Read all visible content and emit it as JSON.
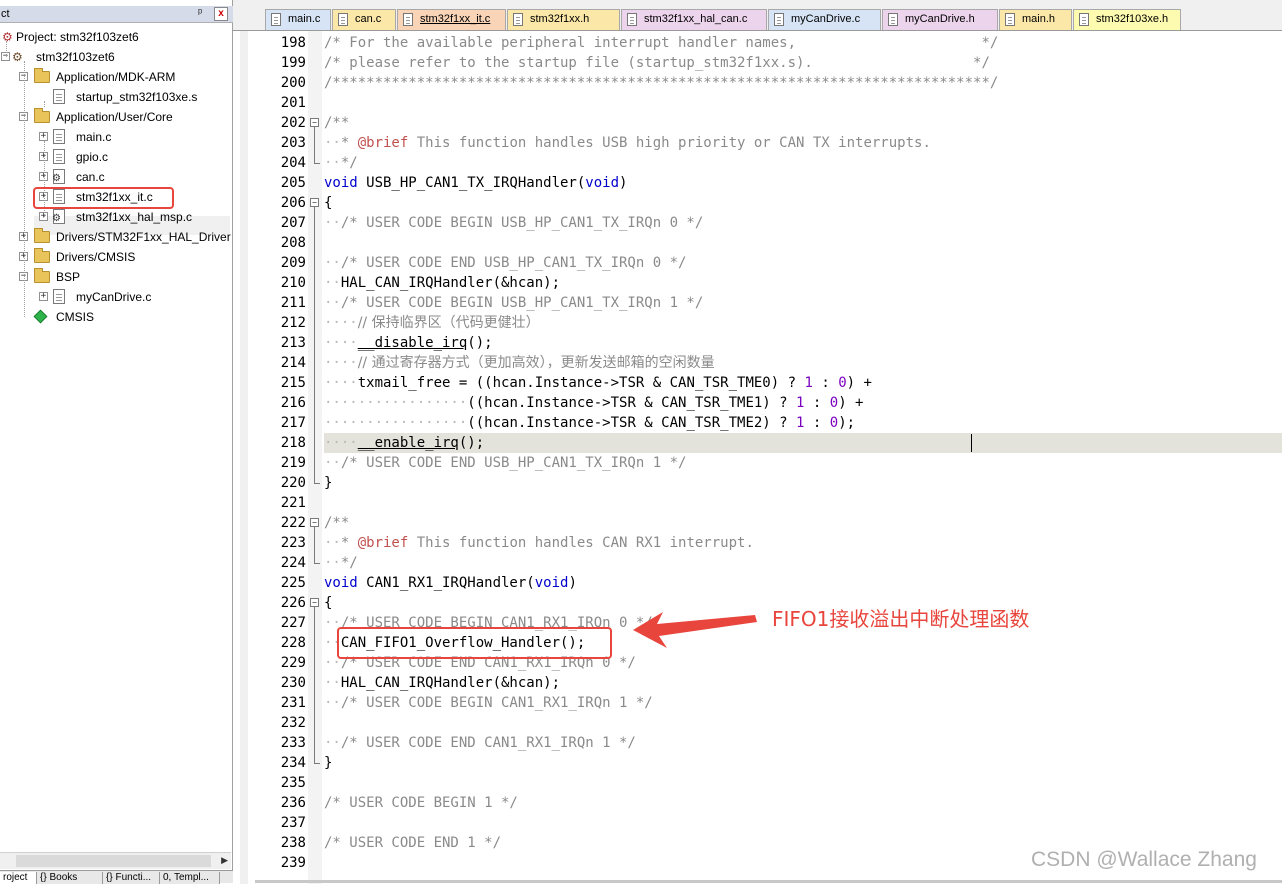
{
  "panel": {
    "title": "ct",
    "pin": "ᵖ",
    "close": "x"
  },
  "tree": [
    {
      "label": "Project: stm32f103zet6",
      "indent": 0,
      "expander": "",
      "icon": "project"
    },
    {
      "label": "stm32f103zet6",
      "indent": 1,
      "expander": "−",
      "icon": "target"
    },
    {
      "label": "Application/MDK-ARM",
      "indent": 2,
      "expander": "−",
      "icon": "folder"
    },
    {
      "label": "startup_stm32f103xe.s",
      "indent": 3,
      "expander": "",
      "icon": "file"
    },
    {
      "label": "Application/User/Core",
      "indent": 2,
      "expander": "−",
      "icon": "folder"
    },
    {
      "label": "main.c",
      "indent": 3,
      "expander": "+",
      "icon": "file"
    },
    {
      "label": "gpio.c",
      "indent": 3,
      "expander": "+",
      "icon": "file"
    },
    {
      "label": "can.c",
      "indent": 3,
      "expander": "+",
      "icon": "gear-file"
    },
    {
      "label": "stm32f1xx_it.c",
      "indent": 3,
      "expander": "+",
      "icon": "file"
    },
    {
      "label": "stm32f1xx_hal_msp.c",
      "indent": 3,
      "expander": "+",
      "icon": "gear-file"
    },
    {
      "label": "Drivers/STM32F1xx_HAL_Driver",
      "indent": 2,
      "expander": "+",
      "icon": "folder"
    },
    {
      "label": "Drivers/CMSIS",
      "indent": 2,
      "expander": "+",
      "icon": "folder"
    },
    {
      "label": "BSP",
      "indent": 2,
      "expander": "−",
      "icon": "folder"
    },
    {
      "label": "myCanDrive.c",
      "indent": 3,
      "expander": "+",
      "icon": "file"
    },
    {
      "label": "CMSIS",
      "indent": 2,
      "expander": "",
      "icon": "cmsis"
    }
  ],
  "bottom_tabs": [
    "roject",
    "{} Books",
    "{} Functi...",
    "0, Templ..."
  ],
  "tabs": [
    {
      "label": "main.c",
      "color": "#d6e4f5",
      "active": false
    },
    {
      "label": "can.c",
      "color": "#fbe8a8",
      "active": false
    },
    {
      "label": "stm32f1xx_it.c",
      "color": "#f9d4b7",
      "active": true
    },
    {
      "label": "stm32f1xx.h",
      "color": "#fbe8a8",
      "active": false
    },
    {
      "label": "stm32f1xx_hal_can.c",
      "color": "#ecd5ec",
      "active": false
    },
    {
      "label": "myCanDrive.c",
      "color": "#d6e4f5",
      "active": false
    },
    {
      "label": "myCanDrive.h",
      "color": "#ecd5ec",
      "active": false
    },
    {
      "label": "main.h",
      "color": "#fbe8a8",
      "active": false
    },
    {
      "label": "stm32f103xe.h",
      "color": "#fdfbb0",
      "active": false
    }
  ],
  "code_lines": [
    {
      "n": "198",
      "fold": "",
      "parts": [
        [
          "c-cm",
          "/* For the available peripheral interrupt handler names,                      */"
        ]
      ]
    },
    {
      "n": "199",
      "fold": "",
      "parts": [
        [
          "c-cm",
          "/* please refer to the startup file (startup_stm32f1xx.s).                   */"
        ]
      ]
    },
    {
      "n": "200",
      "fold": "",
      "parts": [
        [
          "c-cm",
          "/******************************************************************************/"
        ]
      ]
    },
    {
      "n": "201",
      "fold": "",
      "parts": []
    },
    {
      "n": "202",
      "fold": "box",
      "parts": [
        [
          "c-cm",
          "/**"
        ]
      ]
    },
    {
      "n": "203",
      "fold": "line",
      "parts": [
        [
          "c-dot",
          "  "
        ],
        [
          "c-cm",
          "* "
        ],
        [
          "c-tag",
          "@brief"
        ],
        [
          "c-cm",
          " This function handles USB high priority or CAN TX interrupts."
        ]
      ]
    },
    {
      "n": "204",
      "fold": "end",
      "parts": [
        [
          "c-dot",
          "  "
        ],
        [
          "c-cm",
          "*/"
        ]
      ]
    },
    {
      "n": "205",
      "fold": "",
      "parts": [
        [
          "c-kw",
          "void"
        ],
        [
          "c-tx",
          " USB_HP_CAN1_TX_IRQHandler("
        ],
        [
          "c-kw",
          "void"
        ],
        [
          "c-tx",
          ")"
        ]
      ]
    },
    {
      "n": "206",
      "fold": "box",
      "parts": [
        [
          "c-tx",
          "{"
        ]
      ]
    },
    {
      "n": "207",
      "fold": "line",
      "parts": [
        [
          "c-dot",
          "  "
        ],
        [
          "c-cm",
          "/* USER CODE BEGIN USB_HP_CAN1_TX_IRQn 0 */"
        ]
      ]
    },
    {
      "n": "208",
      "fold": "line",
      "parts": []
    },
    {
      "n": "209",
      "fold": "line",
      "parts": [
        [
          "c-dot",
          "  "
        ],
        [
          "c-cm",
          "/* USER CODE END USB_HP_CAN1_TX_IRQn 0 */"
        ]
      ]
    },
    {
      "n": "210",
      "fold": "line",
      "parts": [
        [
          "c-dot",
          "  "
        ],
        [
          "c-tx",
          "HAL_CAN_IRQHandler(&hcan);"
        ]
      ]
    },
    {
      "n": "211",
      "fold": "line",
      "parts": [
        [
          "c-dot",
          "  "
        ],
        [
          "c-cm",
          "/* USER CODE BEGIN USB_HP_CAN1_TX_IRQn 1 */"
        ]
      ]
    },
    {
      "n": "212",
      "fold": "line",
      "parts": [
        [
          "c-dot",
          "    "
        ],
        [
          "c-cn",
          "// 保持临界区（代码更健壮）"
        ]
      ]
    },
    {
      "n": "213",
      "fold": "line",
      "parts": [
        [
          "c-dot",
          "    "
        ],
        [
          "c-ul",
          "__disable_irq"
        ],
        [
          "c-tx",
          "();"
        ]
      ]
    },
    {
      "n": "214",
      "fold": "line",
      "parts": [
        [
          "c-dot",
          "    "
        ],
        [
          "c-cn",
          "// 通过寄存器方式（更加高效），更新发送邮箱的空闲数量"
        ]
      ]
    },
    {
      "n": "215",
      "fold": "line",
      "parts": [
        [
          "c-dot",
          "    "
        ],
        [
          "c-tx",
          "txmail_free = ((hcan.Instance->TSR & CAN_TSR_TME0) ? "
        ],
        [
          "c-num",
          "1"
        ],
        [
          "c-tx",
          " : "
        ],
        [
          "c-num",
          "0"
        ],
        [
          "c-tx",
          ") +"
        ]
      ]
    },
    {
      "n": "216",
      "fold": "line",
      "parts": [
        [
          "c-dot",
          "                 "
        ],
        [
          "c-tx",
          "((hcan.Instance->TSR & CAN_TSR_TME1) ? "
        ],
        [
          "c-num",
          "1"
        ],
        [
          "c-tx",
          " : "
        ],
        [
          "c-num",
          "0"
        ],
        [
          "c-tx",
          ") +"
        ]
      ]
    },
    {
      "n": "217",
      "fold": "line",
      "parts": [
        [
          "c-dot",
          "                 "
        ],
        [
          "c-tx",
          "((hcan.Instance->TSR & CAN_TSR_TME2) ? "
        ],
        [
          "c-num",
          "1"
        ],
        [
          "c-tx",
          " : "
        ],
        [
          "c-num",
          "0"
        ],
        [
          "c-tx",
          ");"
        ]
      ]
    },
    {
      "n": "218",
      "fold": "line",
      "parts": [
        [
          "c-dot",
          "    "
        ],
        [
          "c-ul",
          "__enable_irq"
        ],
        [
          "c-tx",
          "();"
        ]
      ]
    },
    {
      "n": "219",
      "fold": "line",
      "parts": [
        [
          "c-dot",
          "  "
        ],
        [
          "c-cm",
          "/* USER CODE END USB_HP_CAN1_TX_IRQn 1 */"
        ]
      ]
    },
    {
      "n": "220",
      "fold": "end",
      "parts": [
        [
          "c-tx",
          "}"
        ]
      ]
    },
    {
      "n": "221",
      "fold": "",
      "parts": []
    },
    {
      "n": "222",
      "fold": "box",
      "parts": [
        [
          "c-cm",
          "/**"
        ]
      ]
    },
    {
      "n": "223",
      "fold": "line",
      "parts": [
        [
          "c-dot",
          "  "
        ],
        [
          "c-cm",
          "* "
        ],
        [
          "c-tag",
          "@brief"
        ],
        [
          "c-cm",
          " This function handles CAN RX1 interrupt."
        ]
      ]
    },
    {
      "n": "224",
      "fold": "end",
      "parts": [
        [
          "c-dot",
          "  "
        ],
        [
          "c-cm",
          "*/"
        ]
      ]
    },
    {
      "n": "225",
      "fold": "",
      "parts": [
        [
          "c-kw",
          "void"
        ],
        [
          "c-tx",
          " CAN1_RX1_IRQHandler("
        ],
        [
          "c-kw",
          "void"
        ],
        [
          "c-tx",
          ")"
        ]
      ]
    },
    {
      "n": "226",
      "fold": "box",
      "parts": [
        [
          "c-tx",
          "{"
        ]
      ]
    },
    {
      "n": "227",
      "fold": "line",
      "parts": [
        [
          "c-dot",
          "  "
        ],
        [
          "c-cm",
          "/* USER CODE BEGIN CAN1_RX1_IRQn 0 */"
        ]
      ]
    },
    {
      "n": "228",
      "fold": "line",
      "parts": [
        [
          "c-dot",
          "  "
        ],
        [
          "c-tx",
          "CAN_FIFO1_Overflow_Handler();"
        ]
      ]
    },
    {
      "n": "229",
      "fold": "line",
      "parts": [
        [
          "c-dot",
          "  "
        ],
        [
          "c-cm",
          "/* USER CODE END CAN1_RX1_IRQn 0 */"
        ]
      ]
    },
    {
      "n": "230",
      "fold": "line",
      "parts": [
        [
          "c-dot",
          "  "
        ],
        [
          "c-tx",
          "HAL_CAN_IRQHandler(&hcan);"
        ]
      ]
    },
    {
      "n": "231",
      "fold": "line",
      "parts": [
        [
          "c-dot",
          "  "
        ],
        [
          "c-cm",
          "/* USER CODE BEGIN CAN1_RX1_IRQn 1 */"
        ]
      ]
    },
    {
      "n": "232",
      "fold": "line",
      "parts": []
    },
    {
      "n": "233",
      "fold": "line",
      "parts": [
        [
          "c-dot",
          "  "
        ],
        [
          "c-cm",
          "/* USER CODE END CAN1_RX1_IRQn 1 */"
        ]
      ]
    },
    {
      "n": "234",
      "fold": "end",
      "parts": [
        [
          "c-tx",
          "}"
        ]
      ]
    },
    {
      "n": "235",
      "fold": "",
      "parts": []
    },
    {
      "n": "236",
      "fold": "",
      "parts": [
        [
          "c-cm",
          "/* USER CODE BEGIN 1 */"
        ]
      ]
    },
    {
      "n": "237",
      "fold": "",
      "parts": []
    },
    {
      "n": "238",
      "fold": "",
      "parts": [
        [
          "c-cm",
          "/* USER CODE END 1 */"
        ]
      ]
    },
    {
      "n": "239",
      "fold": "",
      "parts": []
    }
  ],
  "annotation": {
    "text": "FIFO1接收溢出中断处理函数",
    "color": "#e8453c"
  },
  "watermark": "CSDN @Wallace Zhang"
}
